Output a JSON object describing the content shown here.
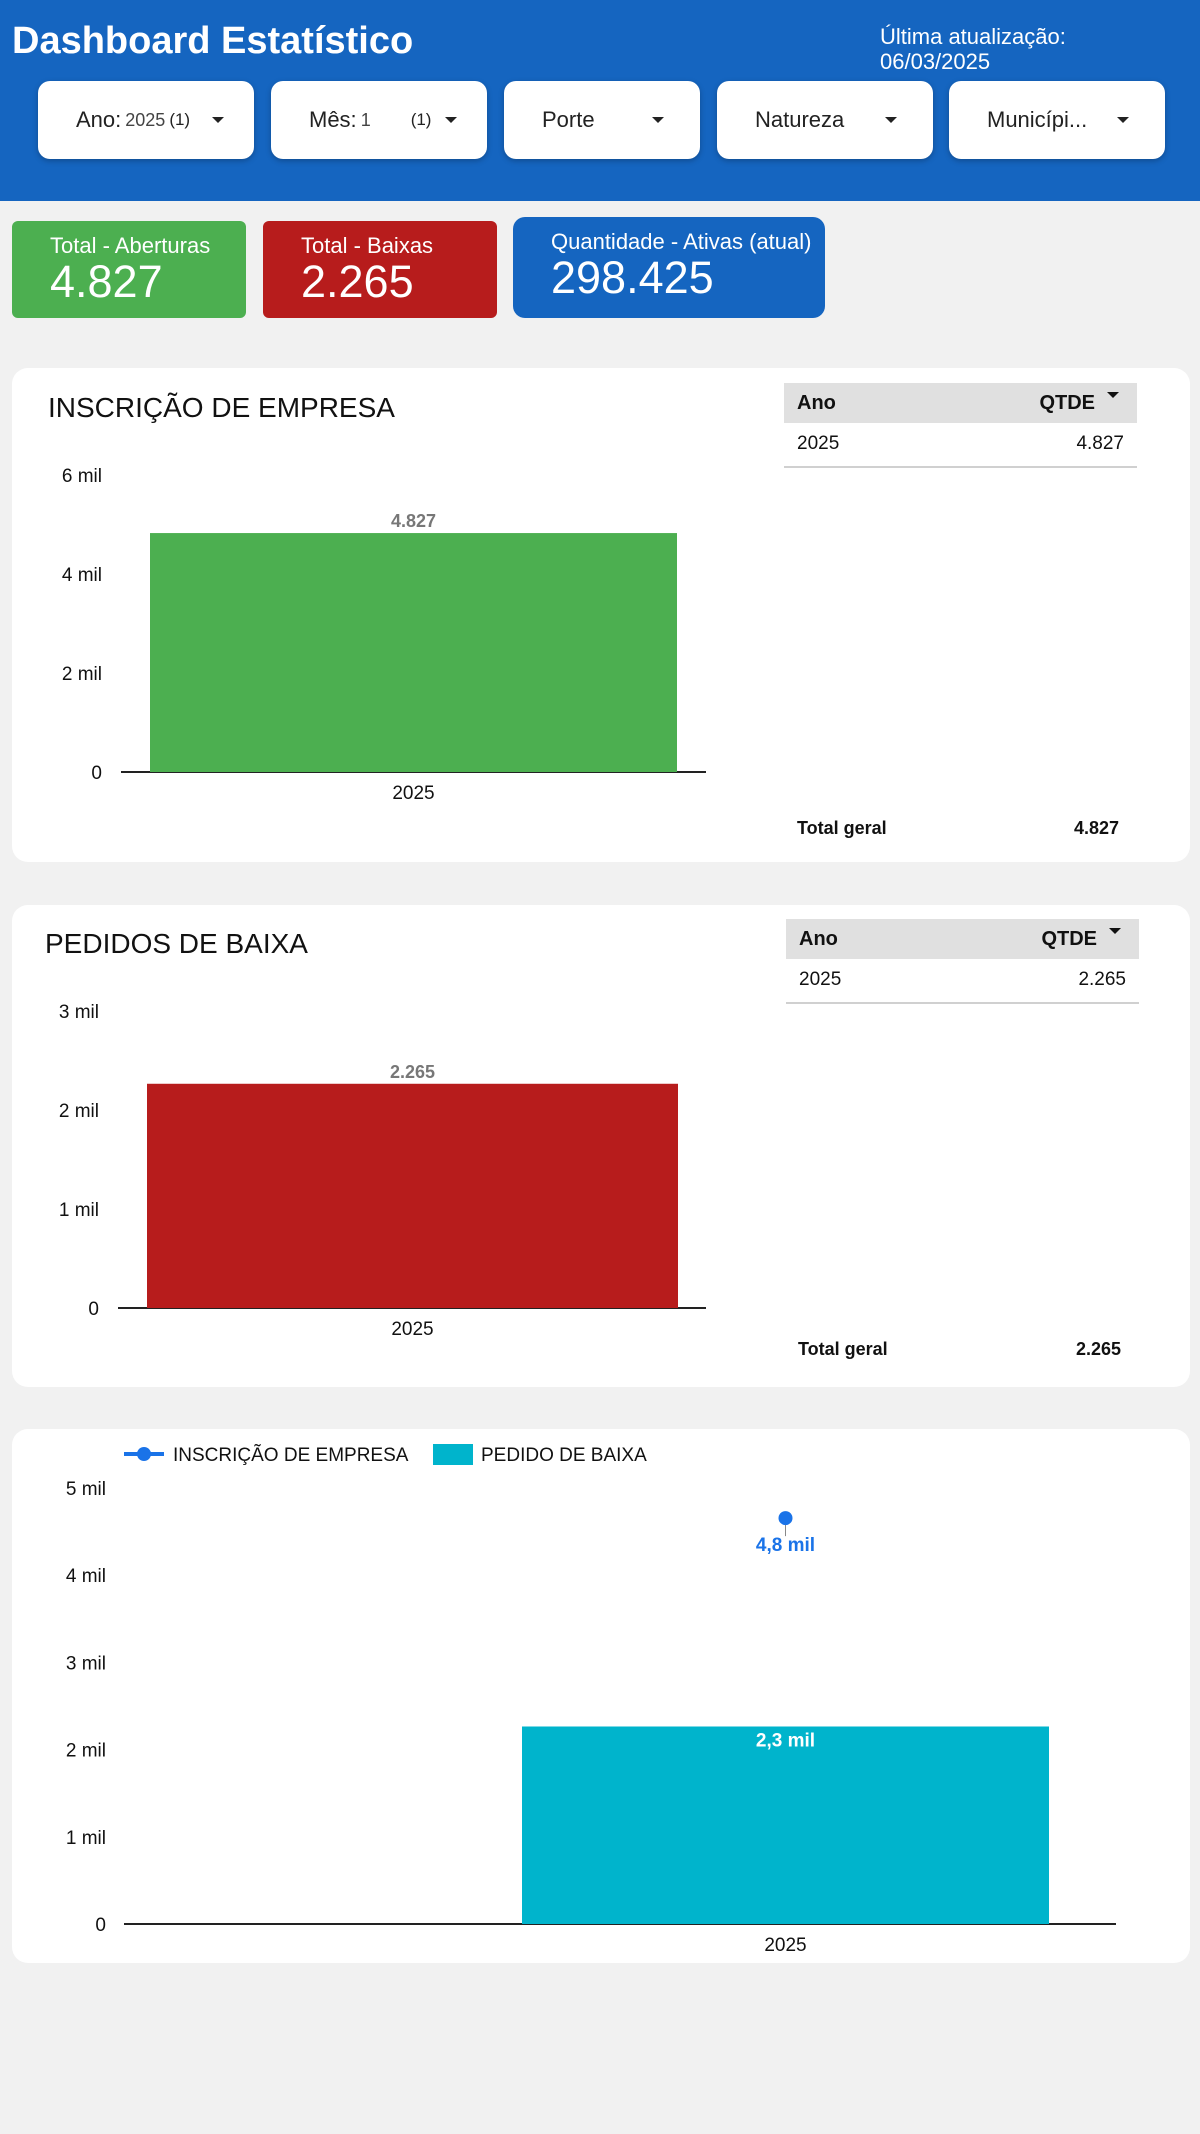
{
  "header": {
    "title": "Dashboard Estatístico",
    "update_label": "Última atualização:",
    "update_date": "06/03/2025"
  },
  "filters": [
    {
      "label": "Ano:",
      "value": "2025",
      "count": "(1)"
    },
    {
      "label": "Mês:",
      "value": "1",
      "count": "(1)"
    },
    {
      "label": "Porte"
    },
    {
      "label": "Natureza"
    },
    {
      "label": "Municípi..."
    }
  ],
  "kpis": [
    {
      "label": "Total - Aberturas",
      "value": "4.827",
      "color": "#4caf50"
    },
    {
      "label": "Total - Baixas",
      "value": "2.265",
      "color": "#b71c1c"
    },
    {
      "label": "Quantidade - Ativas (atual)",
      "value": "298.425",
      "color": "#1565c0"
    }
  ],
  "inscricao": {
    "title": "INSCRIÇÃO DE EMPRESA",
    "table": {
      "col1": "Ano",
      "col2": "QTDE",
      "rows": [
        {
          "ano": "2025",
          "qtde": "4.827"
        }
      ],
      "total_label": "Total geral",
      "total_value": "4.827"
    }
  },
  "baixa": {
    "title": "PEDIDOS DE BAIXA",
    "table": {
      "col1": "Ano",
      "col2": "QTDE",
      "rows": [
        {
          "ano": "2025",
          "qtde": "2.265"
        }
      ],
      "total_label": "Total geral",
      "total_value": "2.265"
    }
  },
  "chart_data": [
    {
      "type": "bar",
      "categories": [
        "2025"
      ],
      "values": [
        4827
      ],
      "data_labels": [
        "4.827"
      ],
      "ylim": [
        0,
        6000
      ],
      "yticks": [
        0,
        2000,
        4000,
        6000
      ],
      "ytick_labels": [
        "0",
        "2 mil",
        "4 mil",
        "6 mil"
      ],
      "color": "#4caf50",
      "grid": false
    },
    {
      "type": "bar",
      "categories": [
        "2025"
      ],
      "values": [
        2265
      ],
      "data_labels": [
        "2.265"
      ],
      "ylim": [
        0,
        3000
      ],
      "yticks": [
        0,
        1000,
        2000,
        3000
      ],
      "ytick_labels": [
        "0",
        "1 mil",
        "2 mil",
        "3 mil"
      ],
      "color": "#b71c1c",
      "grid": false
    },
    {
      "type": "bar",
      "categories": [
        "2025"
      ],
      "series": [
        {
          "name": "INSCRIÇÃO DE EMPRESA",
          "type": "line",
          "values": [
            4827
          ],
          "data_labels": [
            "4,8 mil"
          ],
          "color": "#1a73e8"
        },
        {
          "name": "PEDIDO DE BAIXA",
          "type": "bar",
          "values": [
            2265
          ],
          "data_labels": [
            "2,3 mil"
          ],
          "color": "#00b4cc"
        }
      ],
      "ylim": [
        0,
        5000
      ],
      "yticks": [
        0,
        1000,
        2000,
        3000,
        4000,
        5000
      ],
      "ytick_labels": [
        "0",
        "1 mil",
        "2 mil",
        "3 mil",
        "4 mil",
        "5 mil"
      ],
      "legend": "top-left",
      "grid": false
    }
  ]
}
